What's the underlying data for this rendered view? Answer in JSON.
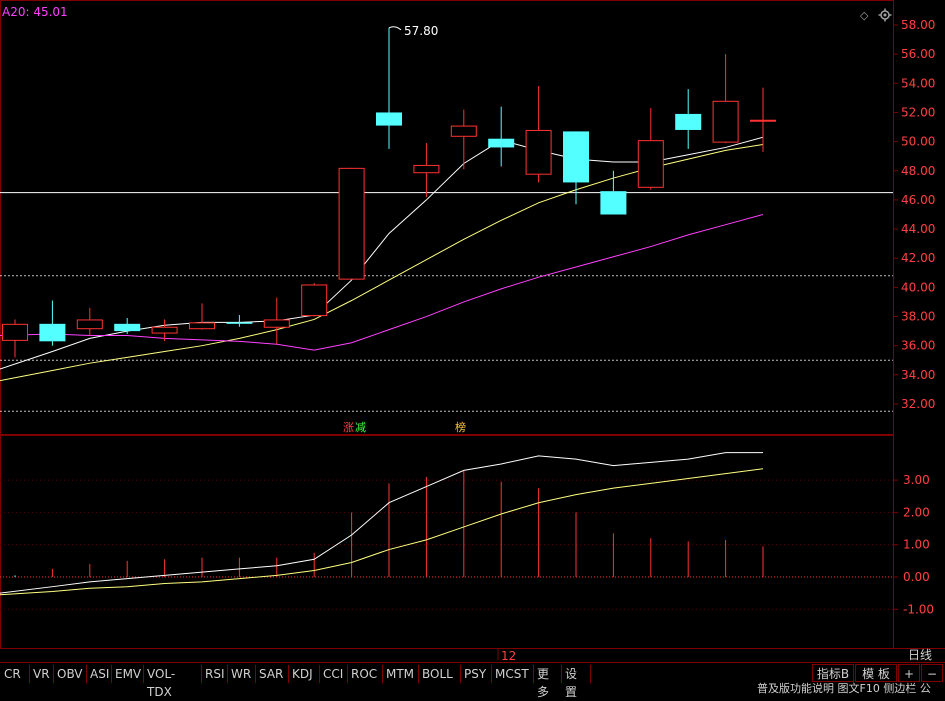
{
  "header": {
    "ma_label": "A20: 45.01",
    "diamond_icon": "diamond-icon",
    "settings_icon": "gear-icon"
  },
  "annotations": {
    "high_value": "57.80",
    "tag_zd": "涨",
    "tag_zd2": "减",
    "tag_bang": "榜",
    "x_tick": "12"
  },
  "colors": {
    "up": "#ff3232",
    "down": "#54ffff",
    "ma1": "#ffffff",
    "ma2": "#ffff80",
    "ma3": "#ff40ff",
    "grid_border": "#800000"
  },
  "toolbar": {
    "items": [
      "CR",
      "VR",
      "OBV",
      "ASI",
      "EMV",
      "VOL-TDX",
      "RSI",
      "WR",
      "SAR",
      "KDJ",
      "CCI",
      "ROC",
      "MTM",
      "BOLL",
      "PSY",
      "MCST",
      "更多",
      "设置"
    ]
  },
  "right_buttons": {
    "indicator_b": "指标B",
    "template": "模 板",
    "plus": "+",
    "minus": "−",
    "daily": "日线"
  },
  "bottom_strip": "普及版功能说明 图文F10 侧边栏 公",
  "chart_data": [
    {
      "type": "candlestick",
      "ylim": [
        31,
        59
      ],
      "y_ticks": [
        "58.00",
        "56.00",
        "54.00",
        "52.00",
        "50.00",
        "48.00",
        "46.00",
        "44.00",
        "42.00",
        "40.00",
        "38.00",
        "36.00",
        "34.00",
        "32.00"
      ],
      "candles": [
        {
          "o": 36.4,
          "c": 37.5,
          "h": 37.8,
          "l": 35.2
        },
        {
          "o": 37.5,
          "c": 36.3,
          "h": 39.1,
          "l": 36.0
        },
        {
          "o": 37.2,
          "c": 37.8,
          "h": 38.6,
          "l": 36.7
        },
        {
          "o": 37.5,
          "c": 37.0,
          "h": 37.9,
          "l": 36.8
        },
        {
          "o": 36.9,
          "c": 37.3,
          "h": 37.8,
          "l": 36.3
        },
        {
          "o": 37.2,
          "c": 37.6,
          "h": 38.9,
          "l": 37.1
        },
        {
          "o": 37.6,
          "c": 37.5,
          "h": 38.1,
          "l": 37.3
        },
        {
          "o": 37.3,
          "c": 37.8,
          "h": 39.3,
          "l": 36.1
        },
        {
          "o": 38.1,
          "c": 40.2,
          "h": 40.3,
          "l": 38.0
        },
        {
          "o": 40.6,
          "c": 48.2,
          "h": 48.2,
          "l": 40.6
        },
        {
          "o": 52.0,
          "c": 51.1,
          "h": 57.8,
          "l": 49.5
        },
        {
          "o": 47.9,
          "c": 48.4,
          "h": 49.9,
          "l": 46.2
        },
        {
          "o": 50.4,
          "c": 51.1,
          "h": 52.2,
          "l": 48.1
        },
        {
          "o": 50.2,
          "c": 49.6,
          "h": 52.4,
          "l": 48.3
        },
        {
          "o": 47.8,
          "c": 50.8,
          "h": 53.8,
          "l": 47.2
        },
        {
          "o": 50.7,
          "c": 47.2,
          "h": 50.7,
          "l": 45.7
        },
        {
          "o": 46.6,
          "c": 45.0,
          "h": 48.0,
          "l": 45.0
        },
        {
          "o": 46.9,
          "c": 50.1,
          "h": 52.3,
          "l": 46.7
        },
        {
          "o": 51.9,
          "c": 50.8,
          "h": 53.6,
          "l": 49.5
        },
        {
          "o": 50.0,
          "c": 52.8,
          "h": 56.0,
          "l": 49.9
        },
        {
          "o": 51.5,
          "c": 51.5,
          "h": 53.7,
          "l": 49.3
        }
      ],
      "ma_series": [
        {
          "values": [
            34.4,
            35.6,
            36.5,
            37.0,
            37.4,
            37.6,
            37.6,
            37.7,
            38.1,
            40.5,
            43.7,
            46.0,
            48.5,
            50.1,
            49.4,
            48.8,
            48.6,
            48.6,
            49.1,
            49.6,
            50.3
          ]
        },
        {
          "values": [
            33.6,
            34.3,
            34.8,
            35.2,
            35.6,
            36.0,
            36.5,
            37.1,
            37.8,
            39.1,
            40.5,
            41.9,
            43.3,
            44.6,
            45.8,
            46.7,
            47.5,
            48.2,
            48.8,
            49.4,
            49.8
          ]
        },
        {
          "values": [
            36.7,
            36.8,
            36.7,
            36.7,
            36.5,
            36.4,
            36.3,
            36.1,
            35.7,
            36.2,
            37.1,
            38.0,
            39.0,
            39.9,
            40.7,
            41.4,
            42.1,
            42.8,
            43.6,
            44.3,
            45.0
          ]
        }
      ],
      "hlines": [
        {
          "y": 46.5,
          "style": "solid"
        },
        {
          "y": 40.8,
          "style": "dotted"
        },
        {
          "y": 35.0,
          "style": "dotted"
        },
        {
          "y": 31.5,
          "style": "dotted"
        }
      ]
    },
    {
      "type": "bar",
      "ylim": [
        -2,
        4
      ],
      "y_ticks": [
        "3.00",
        "2.00",
        "1.00",
        "0.00",
        "-1.00"
      ],
      "values": [
        0.05,
        0.25,
        0.4,
        0.5,
        0.55,
        0.6,
        0.6,
        0.6,
        0.75,
        2.0,
        2.9,
        3.1,
        3.3,
        2.95,
        2.75,
        2.0,
        1.35,
        1.2,
        1.1,
        1.15,
        0.95
      ],
      "lines": [
        {
          "values": [
            -0.5,
            -0.3,
            -0.15,
            -0.05,
            0.05,
            0.15,
            0.25,
            0.35,
            0.55,
            1.3,
            2.3,
            2.8,
            3.3,
            3.5,
            3.75,
            3.65,
            3.45,
            3.55,
            3.65,
            3.85,
            3.85
          ]
        },
        {
          "values": [
            -0.55,
            -0.45,
            -0.35,
            -0.3,
            -0.2,
            -0.15,
            -0.05,
            0.05,
            0.2,
            0.45,
            0.85,
            1.15,
            1.55,
            1.95,
            2.3,
            2.55,
            2.75,
            2.9,
            3.05,
            3.2,
            3.35
          ]
        }
      ]
    }
  ]
}
